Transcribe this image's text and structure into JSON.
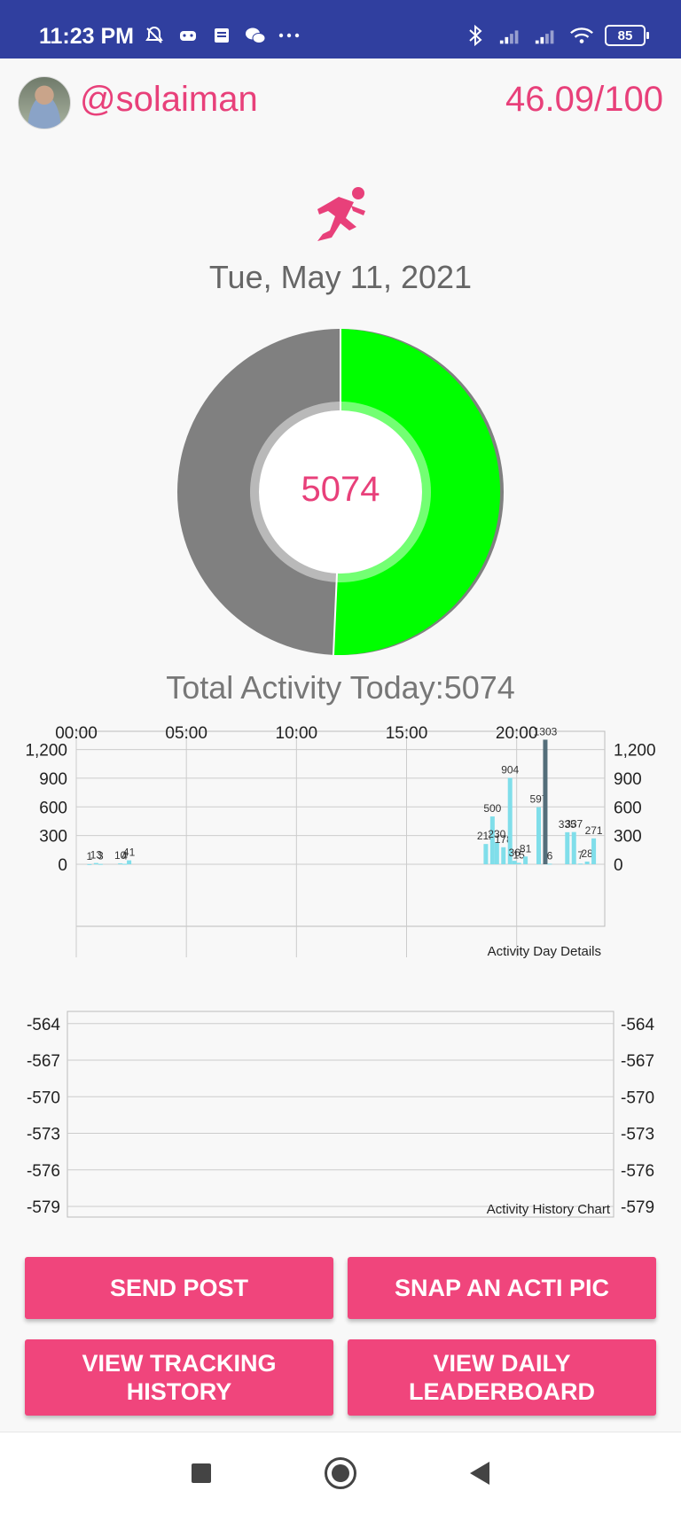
{
  "status_bar": {
    "time": "11:23 PM",
    "battery": "85",
    "left_icons": [
      "bell-muted-icon",
      "game-icon",
      "news-icon",
      "wechat-icon",
      "more-dots-icon"
    ],
    "right_icons": [
      "bluetooth-icon",
      "signal-1-icon",
      "signal-2-icon",
      "wifi-icon",
      "battery-icon"
    ]
  },
  "header": {
    "username": "@solaiman",
    "score": "46.09/100"
  },
  "main": {
    "date": "Tue, May 11, 2021",
    "donut_value": "5074",
    "total_label": "Total Activity Today:5074",
    "colors": {
      "accent": "#e8407a",
      "progress": "#00ff00",
      "remaining": "#808080",
      "bar": "#80deea",
      "bar_highlight": "#546e7a"
    }
  },
  "chart_data": [
    {
      "type": "bar",
      "title": "Activity Day Details",
      "x_tick_labels": [
        "00:00",
        "05:00",
        "10:00",
        "15:00",
        "20:00"
      ],
      "x_range_hours": [
        0,
        24
      ],
      "y_ticks": [
        0,
        300,
        600,
        900,
        1200
      ],
      "y_tick_labels": [
        "0",
        "300",
        "600",
        "900",
        "1,200"
      ],
      "ylim": [
        0,
        1400
      ],
      "grid": true,
      "points": [
        {
          "x": 0.6,
          "value": 1,
          "label": "1"
        },
        {
          "x": 0.9,
          "value": 13,
          "label": "13"
        },
        {
          "x": 1.1,
          "value": 3,
          "label": "3"
        },
        {
          "x": 2.0,
          "value": 10,
          "label": "10"
        },
        {
          "x": 2.2,
          "value": 4,
          "label": "4"
        },
        {
          "x": 2.4,
          "value": 41,
          "label": "41"
        },
        {
          "x": 18.6,
          "value": 212,
          "label": "212"
        },
        {
          "x": 18.9,
          "value": 500,
          "label": "500"
        },
        {
          "x": 19.1,
          "value": 230,
          "label": "230"
        },
        {
          "x": 19.4,
          "value": 178,
          "label": "178"
        },
        {
          "x": 19.7,
          "value": 904,
          "label": "904"
        },
        {
          "x": 19.9,
          "value": 36,
          "label": "36"
        },
        {
          "x": 20.1,
          "value": 15,
          "label": "15"
        },
        {
          "x": 20.4,
          "value": 81,
          "label": "81"
        },
        {
          "x": 21.0,
          "value": 597,
          "label": "597"
        },
        {
          "x": 21.3,
          "value": 1303,
          "label": "1303",
          "highlight": true
        },
        {
          "x": 21.5,
          "value": 6,
          "label": "6"
        },
        {
          "x": 22.3,
          "value": 335,
          "label": "335"
        },
        {
          "x": 22.6,
          "value": 337,
          "label": "337"
        },
        {
          "x": 22.9,
          "value": 7,
          "label": "7"
        },
        {
          "x": 23.2,
          "value": 28,
          "label": "28"
        },
        {
          "x": 23.5,
          "value": 271,
          "label": "271"
        }
      ]
    },
    {
      "type": "line",
      "title": "Activity History Chart",
      "y_ticks": [
        -579,
        -576,
        -573,
        -570,
        -567,
        -564
      ],
      "y_tick_labels": [
        "-579",
        "-576",
        "-573",
        "-570",
        "-567",
        "-564"
      ],
      "ylim": [
        -579,
        -563
      ],
      "grid": true,
      "series": []
    }
  ],
  "buttons": {
    "send_post": "SEND POST",
    "snap_pic": "SNAP AN ACTI PIC",
    "view_tracking": "VIEW TRACKING\nHISTORY",
    "view_leaderboard": "VIEW DAILY\nLEADERBOARD"
  },
  "nav": [
    "recent-apps-icon",
    "home-icon",
    "back-icon"
  ]
}
